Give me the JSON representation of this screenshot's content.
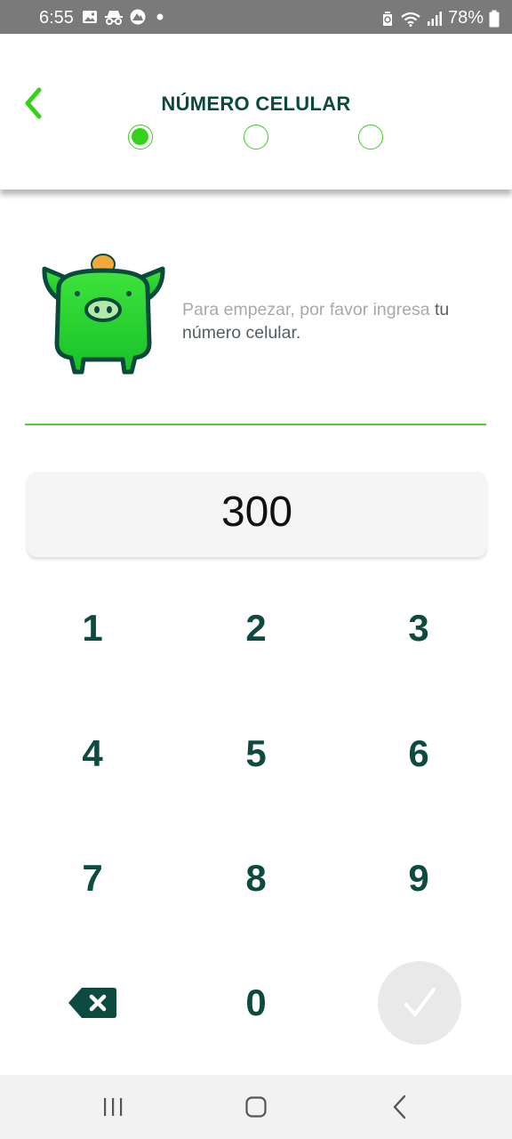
{
  "status_bar": {
    "time": "6:55",
    "battery": "78%",
    "icons": [
      "image-icon",
      "incognito-icon",
      "mountain-badge-icon",
      "dot-icon",
      "recycle-icon",
      "wifi-icon",
      "signal-icon",
      "battery-icon"
    ]
  },
  "header": {
    "back_icon": "chevron-left-icon",
    "title": "NÚMERO CELULAR",
    "steps_total": 3,
    "step_active": 1
  },
  "intro": {
    "text_plain": "Para empezar, por favor ingresa ",
    "text_bold": "tu número celular."
  },
  "phone": {
    "value": "300"
  },
  "keypad": {
    "keys": [
      "1",
      "2",
      "3",
      "4",
      "5",
      "6",
      "7",
      "8",
      "9",
      "0"
    ],
    "delete_icon": "backspace-icon",
    "submit_icon": "check-icon"
  },
  "nav": {
    "icons": [
      "recents-icon",
      "home-icon",
      "back-icon"
    ]
  },
  "colors": {
    "accent": "#35d21a",
    "title_dark": "#0a4a3c",
    "key_text": "#0d4a40",
    "display_bg": "#f5f5f5"
  }
}
